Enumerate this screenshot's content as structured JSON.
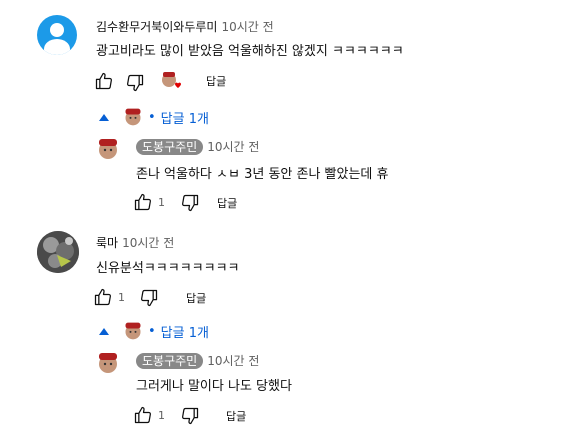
{
  "comments": [
    {
      "author": "김수환무거북이와두루미",
      "time": "10시간 전",
      "text": "광고비라도 많이 받았음 억울해하진 않겠지 ㅋㅋㅋㅋㅋㅋ",
      "like_count": "",
      "reply_label": "답글",
      "replies_toggle": "답글 1개",
      "reply": {
        "author": "도봉구주민",
        "time": "10시간 전",
        "text": "존나 억울하다 ㅅㅂ 3년 동안 존나 빨았는데 휴",
        "like_count": "1",
        "reply_label": "답글"
      }
    },
    {
      "author": "룩마",
      "time": "10시간 전",
      "text": "신유분석ㅋㅋㅋㅋㅋㅋㅋㅋ",
      "like_count": "1",
      "reply_label": "답글",
      "replies_toggle": "답글 1개",
      "reply": {
        "author": "도봉구주민",
        "time": "10시간 전",
        "text": "그러게나 말이다 나도 당했다",
        "like_count": "1",
        "reply_label": "답글"
      }
    }
  ],
  "icons": {
    "like": "thumbs-up-icon",
    "dislike": "thumbs-down-icon",
    "creator_heart": "creator-heart-icon"
  },
  "colors": {
    "link_blue": "#065fd4",
    "avatar_blue": "#1c9ae8",
    "chip_gray": "#888888",
    "heart_red": "#e00000"
  }
}
